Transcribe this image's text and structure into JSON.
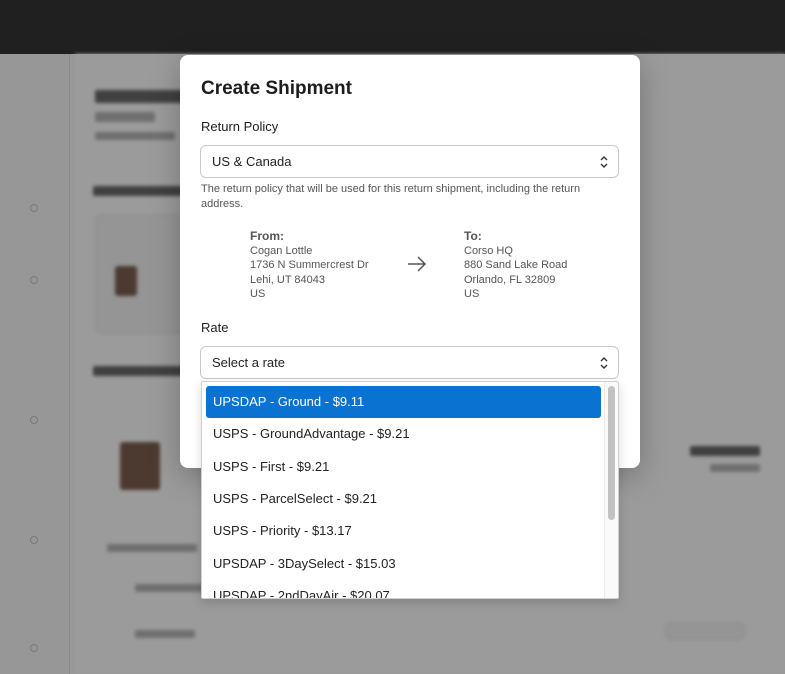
{
  "modal": {
    "title": "Create Shipment",
    "return_policy_label": "Return Policy",
    "return_policy_value": "US & Canada",
    "return_policy_help": "The return policy that will be used for this return shipment, including the return address.",
    "from": {
      "heading": "From:",
      "lines": [
        "Cogan Lottle",
        "1736 N Summercrest Dr",
        "Lehi, UT 84043",
        "US"
      ]
    },
    "to": {
      "heading": "To:",
      "lines": [
        "Corso HQ",
        "880 Sand Lake Road",
        "Orlando, FL 32809",
        "US"
      ]
    },
    "rate_label": "Rate",
    "rate_placeholder": "Select a rate"
  },
  "rate_options": [
    "UPSDAP - Ground - $9.11",
    "USPS - GroundAdvantage - $9.21",
    "USPS - First - $9.21",
    "USPS - ParcelSelect - $9.21",
    "USPS - Priority - $13.17",
    "UPSDAP - 3DaySelect - $15.03",
    "UPSDAP - 2ndDayAir - $20.07"
  ],
  "highlighted_option_index": 0,
  "colors": {
    "highlight": "#0a72d1",
    "overlay": "rgba(40,40,40,0.45)",
    "topbar": "#1a1a1a"
  },
  "icons": {
    "select_chevron": "chevron-up-down-icon",
    "address_arrow": "arrow-right-icon"
  }
}
